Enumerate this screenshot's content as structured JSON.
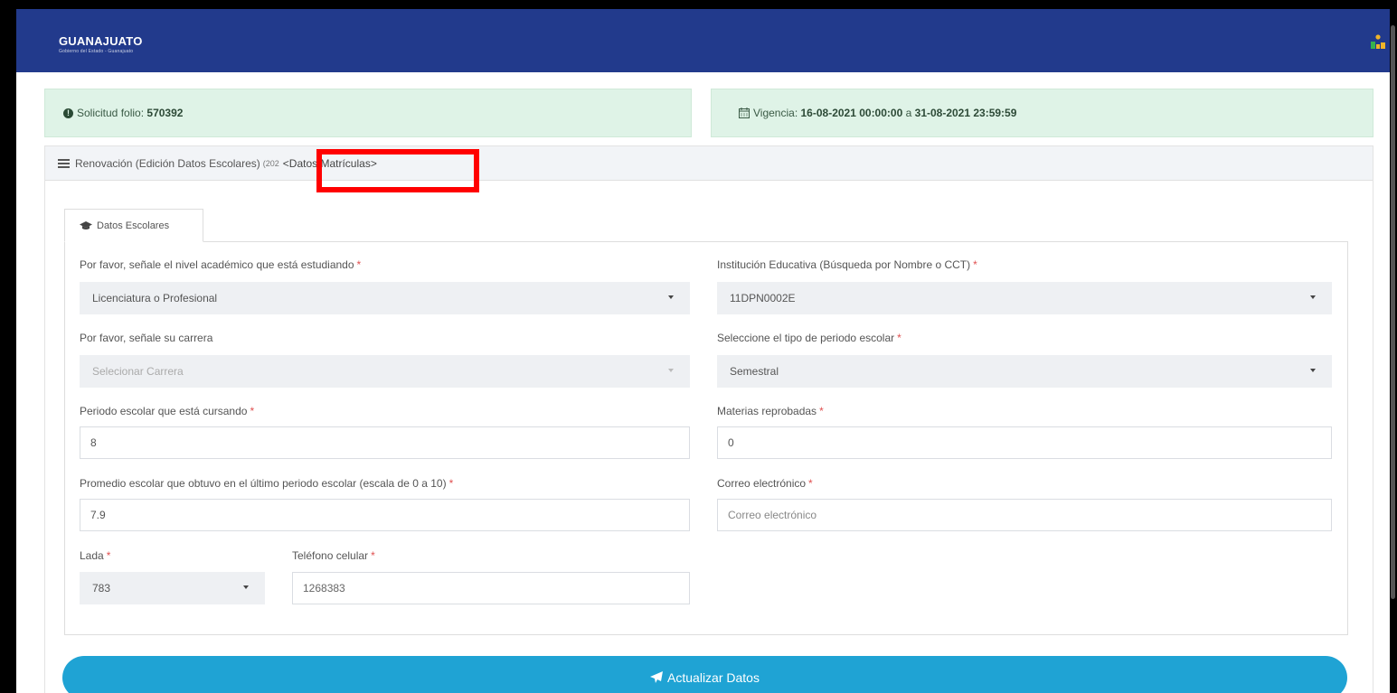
{
  "header": {
    "brand_title": "GUANAJUATO",
    "brand_subtitle": "Gobierno del Estado - Guanajuato",
    "logo_icon": "sube-logo-icon",
    "nav_color": "#223a8c"
  },
  "folio": {
    "label": "Solicitud folio:",
    "value": "570392",
    "icon": "info-circle-icon"
  },
  "vigencia": {
    "label": "Vigencia:",
    "start": "16-08-2021 00:00:00",
    "separator": "a",
    "end": "31-08-2021 23:59:59",
    "icon": "calendar-icon"
  },
  "panel": {
    "title": "Renovación (Edición Datos Escolares)",
    "year_fragment": "(202",
    "link_text": "<Datos Matrículas>",
    "highlight_color": "#ff0000"
  },
  "tab": {
    "label": "Datos Escolares",
    "icon": "graduation-cap-icon"
  },
  "form": {
    "nivel": {
      "label": "Por favor, señale el nivel académico que está estudiando",
      "value": "Licenciatura o Profesional",
      "required": "*"
    },
    "institucion": {
      "label": "Institución Educativa (Búsqueda por Nombre o CCT)",
      "value": "11DPN0002E",
      "required": "*"
    },
    "carrera": {
      "label": "Por favor, señale su carrera",
      "value": "Selecionar Carrera"
    },
    "tipo_periodo": {
      "label": "Seleccione el tipo de periodo escolar",
      "value": "Semestral",
      "required": "*"
    },
    "periodo": {
      "label": "Periodo escolar que está cursando",
      "value": "8",
      "required": "*"
    },
    "materias": {
      "label": "Materias reprobadas",
      "value": "0",
      "required": "*"
    },
    "promedio": {
      "label": "Promedio escolar que obtuvo en el último periodo escolar (escala de 0 a 10)",
      "value": "7.9",
      "required": "*"
    },
    "correo": {
      "label": "Correo electrónico",
      "placeholder": "Correo electrónico",
      "required": "*"
    },
    "lada": {
      "label": "Lada",
      "value": "783",
      "required": "*"
    },
    "telefono": {
      "label": "Teléfono celular",
      "value": "1268383",
      "required": "*"
    }
  },
  "submit": {
    "label": "Actualizar Datos",
    "icon": "paper-plane-icon",
    "color": "#1fa3d4"
  }
}
